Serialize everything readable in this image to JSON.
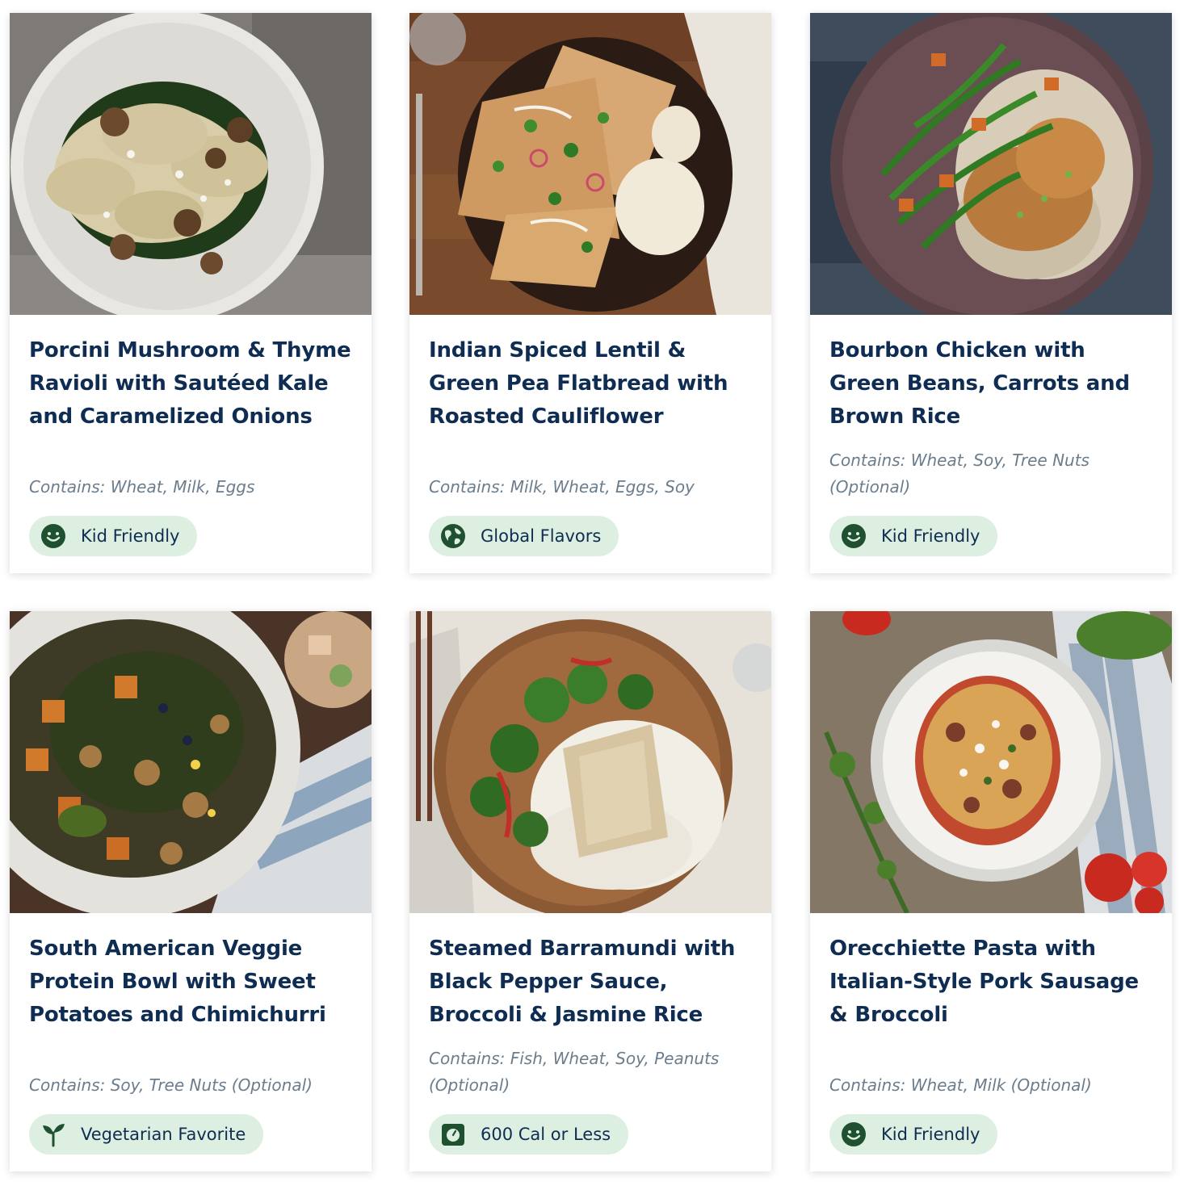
{
  "recipes": [
    {
      "title": "Porcini Mushroom & Thyme Ravioli with Sautéed Kale and Caramelized Onions",
      "allergens": "Contains: Wheat, Milk, Eggs",
      "tag": {
        "label": "Kid Friendly",
        "icon": "smiley-icon"
      }
    },
    {
      "title": "Indian Spiced Lentil & Green Pea Flatbread with Roasted Cauliflower",
      "allergens": "Contains: Milk, Wheat, Eggs, Soy",
      "tag": {
        "label": "Global Flavors",
        "icon": "globe-icon"
      }
    },
    {
      "title": "Bourbon Chicken with Green Beans, Carrots and Brown Rice",
      "allergens": "Contains: Wheat, Soy, Tree Nuts (Optional)",
      "tag": {
        "label": "Kid Friendly",
        "icon": "smiley-icon"
      }
    },
    {
      "title": "South American Veggie Protein Bowl with Sweet Potatoes and Chimichurri",
      "allergens": "Contains: Soy, Tree Nuts (Optional)",
      "tag": {
        "label": "Vegetarian Favorite",
        "icon": "sprout-icon"
      }
    },
    {
      "title": "Steamed Barramundi with Black Pepper Sauce, Broccoli & Jasmine Rice",
      "allergens": "Contains: Fish, Wheat, Soy, Peanuts (Optional)",
      "tag": {
        "label": "600 Cal or Less",
        "icon": "scale-icon"
      }
    },
    {
      "title": "Orecchiette Pasta with Italian-Style Pork Sausage & Broccoli",
      "allergens": "Contains: Wheat, Milk (Optional)",
      "tag": {
        "label": "Kid Friendly",
        "icon": "smiley-icon"
      }
    }
  ],
  "colors": {
    "title": "#0f2d52",
    "allergens": "#6b7d8d",
    "badge_bg": "#dcefe1",
    "badge_icon": "#1f5130"
  }
}
